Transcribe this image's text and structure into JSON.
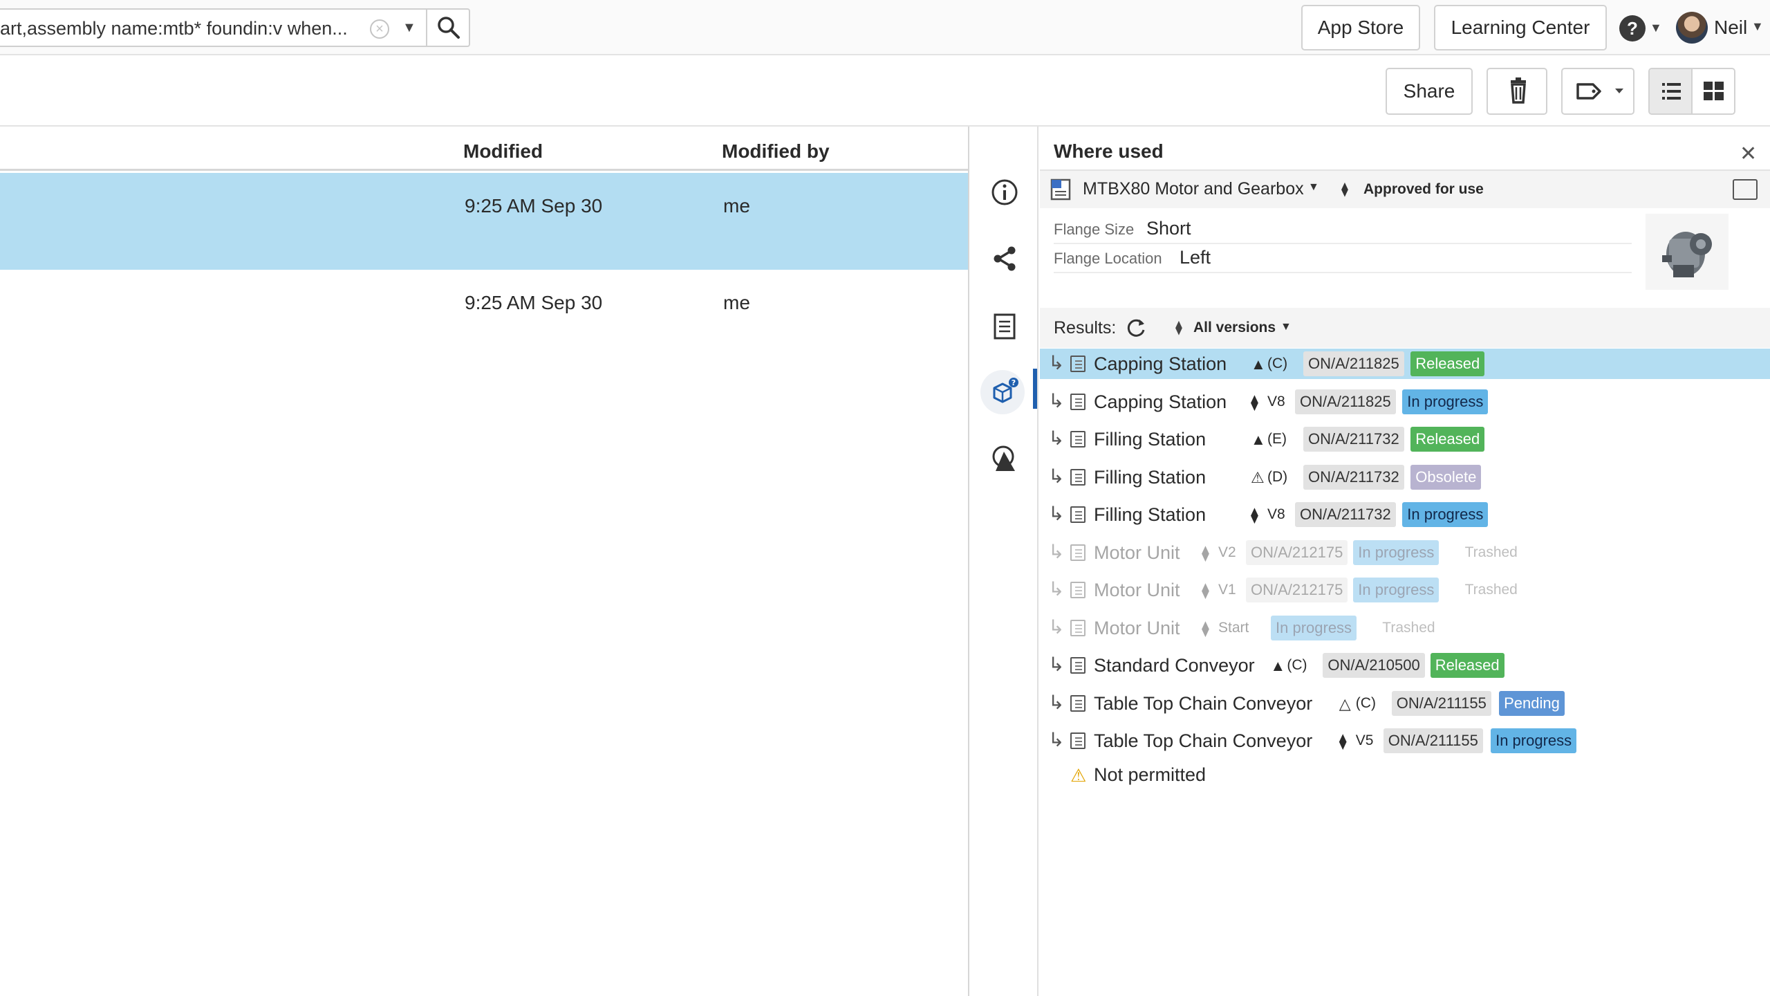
{
  "topbar": {
    "search_text": "art,assembly name:mtb* foundin:v when...",
    "app_store": "App Store",
    "learning_center": "Learning Center",
    "help_icon_glyph": "?",
    "user_name": "Neil"
  },
  "toolbar": {
    "share": "Share"
  },
  "list": {
    "col_modified": "Modified",
    "col_modified_by": "Modified by",
    "rows": [
      {
        "modified": "9:25 AM Sep 30",
        "modified_by": "me",
        "selected": true
      },
      {
        "modified": "9:25 AM Sep 30",
        "modified_by": "me",
        "selected": false
      }
    ]
  },
  "panel": {
    "title": "Where used",
    "item": {
      "name": "MTBX80 Motor and Gearbox",
      "state": "Approved for use"
    },
    "config": [
      {
        "label": "Flange Size",
        "value": "Short"
      },
      {
        "label": "Flange Location",
        "value": "Left"
      }
    ],
    "results_label": "Results:",
    "versions_label": "All versions",
    "results": [
      {
        "name": "Capping Station",
        "rev_glyph": "▲",
        "rev": "(C)",
        "part_number": "ON/A/211825",
        "status": "Released",
        "trashed": "",
        "selected": true,
        "dim": false
      },
      {
        "name": "Capping Station",
        "rev_glyph": "⧫",
        "rev": "V8",
        "part_number": "ON/A/211825",
        "status": "In progress",
        "trashed": "",
        "selected": false,
        "dim": false
      },
      {
        "name": "Filling Station",
        "rev_glyph": "▲",
        "rev": "(E)",
        "part_number": "ON/A/211732",
        "status": "Released",
        "trashed": "",
        "selected": false,
        "dim": false
      },
      {
        "name": "Filling Station",
        "rev_glyph": "⚠",
        "rev": "(D)",
        "part_number": "ON/A/211732",
        "status": "Obsolete",
        "trashed": "",
        "selected": false,
        "dim": false
      },
      {
        "name": "Filling Station",
        "rev_glyph": "⧫",
        "rev": "V8",
        "part_number": "ON/A/211732",
        "status": "In progress",
        "trashed": "",
        "selected": false,
        "dim": false
      },
      {
        "name": "Motor Unit",
        "rev_glyph": "⧫",
        "rev": "V2",
        "part_number": "ON/A/212175",
        "status": "In progress",
        "trashed": "Trashed",
        "selected": false,
        "dim": true
      },
      {
        "name": "Motor Unit",
        "rev_glyph": "⧫",
        "rev": "V1",
        "part_number": "ON/A/212175",
        "status": "In progress",
        "trashed": "Trashed",
        "selected": false,
        "dim": true
      },
      {
        "name": "Motor Unit",
        "rev_glyph": "⧫",
        "rev": "Start",
        "part_number": "",
        "status": "In progress",
        "trashed": "Trashed",
        "selected": false,
        "dim": true
      },
      {
        "name": "Standard Conveyor",
        "rev_glyph": "▲",
        "rev": "(C)",
        "part_number": "ON/A/210500",
        "status": "Released",
        "trashed": "",
        "selected": false,
        "dim": false
      },
      {
        "name": "Table Top Chain Conveyor",
        "rev_glyph": "△",
        "rev": "(C)",
        "part_number": "ON/A/211155",
        "status": "Pending",
        "trashed": "",
        "selected": false,
        "dim": false
      },
      {
        "name": "Table Top Chain Conveyor",
        "rev_glyph": "⧫",
        "rev": "V5",
        "part_number": "ON/A/211155",
        "status": "In progress",
        "trashed": "",
        "selected": false,
        "dim": false
      }
    ],
    "not_permitted": "Not permitted"
  },
  "icons": {
    "rail": [
      "info-icon",
      "share-icon",
      "details-icon",
      "where-used-icon",
      "compare-icon"
    ]
  }
}
